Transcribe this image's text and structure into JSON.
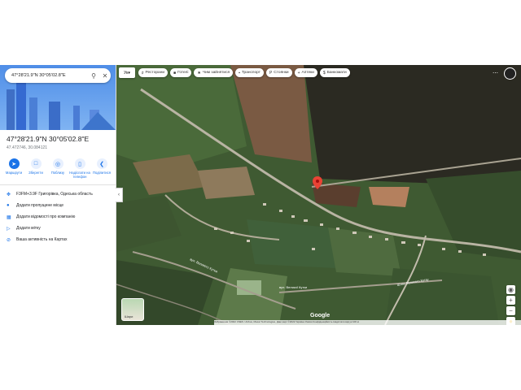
{
  "search": {
    "value": "47°28'21.9\"N 30°05'02.8\"E"
  },
  "place": {
    "title": "47°28'21.9\"N 30°05'02.8\"E",
    "coords": "47.472746, 30.084121"
  },
  "actions": [
    {
      "label": "Маршрути",
      "icon": "directions-icon"
    },
    {
      "label": "Зберегти",
      "icon": "bookmark-icon"
    },
    {
      "label": "Поблизу",
      "icon": "nearby-icon"
    },
    {
      "label": "Надіслати на телефон",
      "icon": "phone-icon"
    },
    {
      "label": "Поділитися",
      "icon": "share-icon"
    }
  ],
  "info": [
    {
      "icon": "plus-code-icon",
      "text": "F3FM+3.9F Григорівка, Одеська область"
    },
    {
      "icon": "pin-icon",
      "text": "Додати пропущене місце"
    },
    {
      "icon": "business-icon",
      "text": "Додати відомості про компанію"
    },
    {
      "icon": "label-icon",
      "text": "Додати мітку"
    },
    {
      "icon": "history-icon",
      "text": "Ваша активність на Картах"
    }
  ],
  "language": "Ук",
  "chips": [
    {
      "icon": "restaurant-icon",
      "label": "Ресторани"
    },
    {
      "icon": "hotel-icon",
      "label": "Готелі"
    },
    {
      "icon": "things-to-do-icon",
      "label": "Чим зайнятися"
    },
    {
      "icon": "transit-icon",
      "label": "Транспорт"
    },
    {
      "icon": "parking-icon",
      "label": "Стоянки"
    },
    {
      "icon": "pharmacy-icon",
      "label": "Аптеки"
    },
    {
      "icon": "atm-icon",
      "label": "Банкомати"
    }
  ],
  "layers_label": "Шари",
  "logo": "Google",
  "footer": "Зображення ©2022 CNES / Airbus, Maxar Technologies, Дані карт ©2022  Україна  Умови  Конфіденційність  Надіслати відгук  100 м",
  "road_labels": [
    "вул. Великого Кутка",
    "вул. Великої Кутки",
    "Шлях Великого Кутку"
  ]
}
